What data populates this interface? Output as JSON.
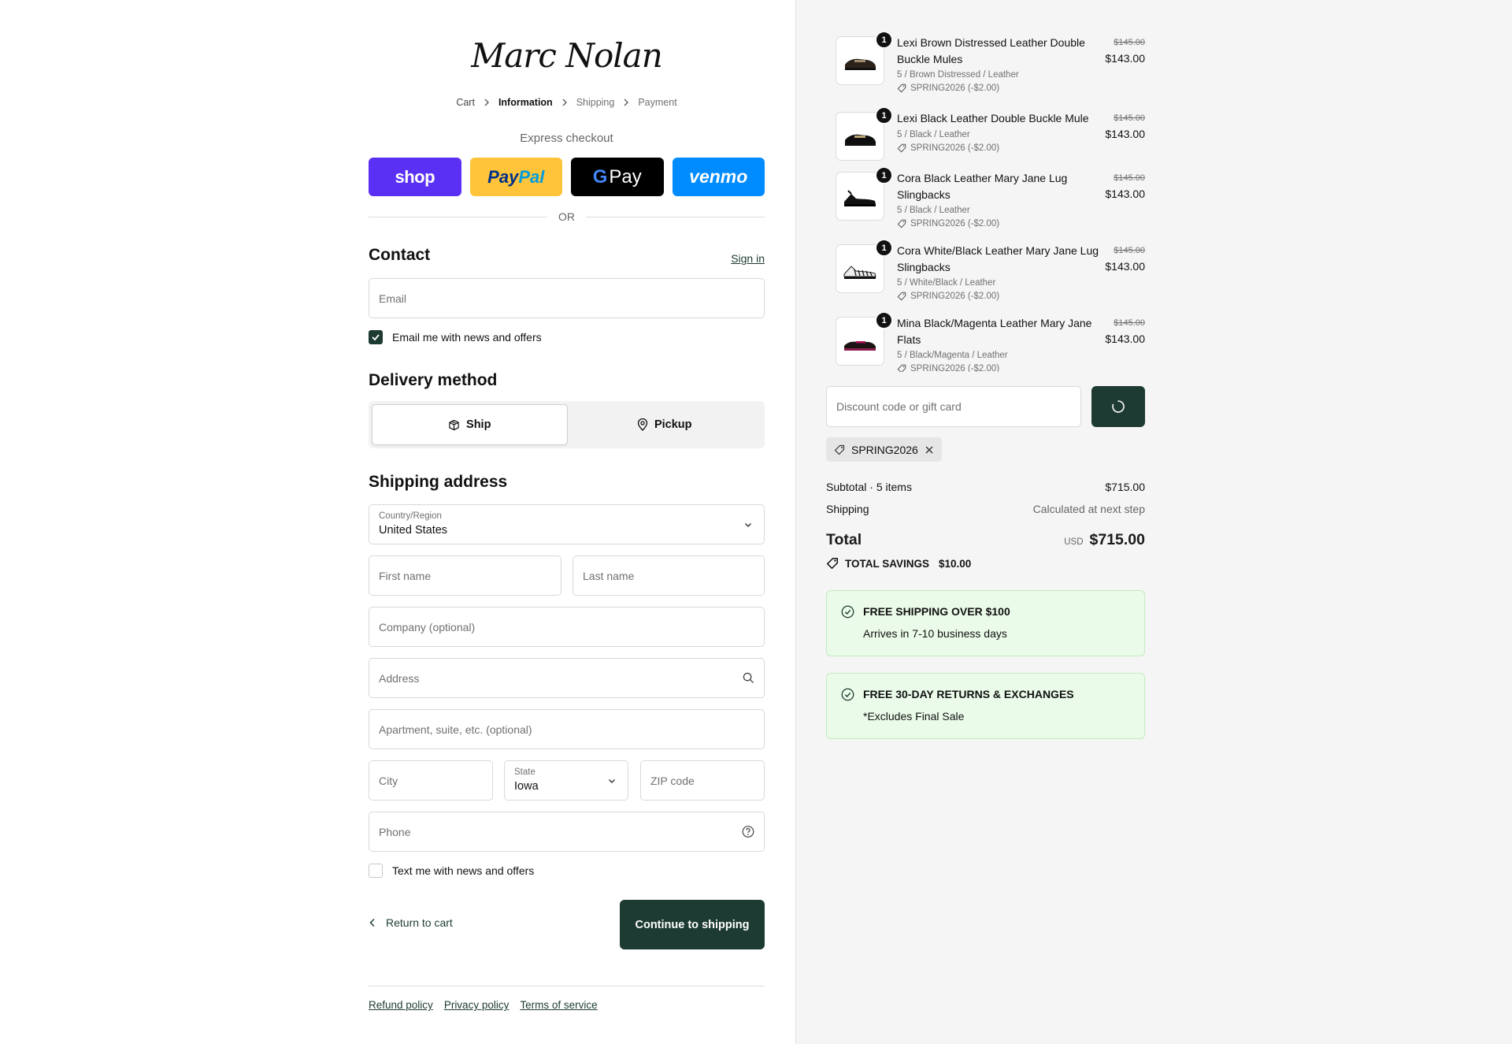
{
  "brand": {
    "logo_text": "Marc Nolan"
  },
  "breadcrumb": [
    "Cart",
    "Information",
    "Shipping",
    "Payment"
  ],
  "express": {
    "label": "Express checkout",
    "buttons": {
      "shop": "shop",
      "paypal_a": "Pay",
      "paypal_b": "Pal",
      "gpay_g": "G",
      "gpay": "Pay",
      "venmo": "venmo"
    },
    "or": "OR"
  },
  "contact": {
    "heading": "Contact",
    "signin": "Sign in",
    "email_placeholder": "Email",
    "news_label": "Email me with news and offers",
    "news_checked": true
  },
  "delivery": {
    "heading": "Delivery method",
    "ship": "Ship",
    "pickup": "Pickup",
    "selected": "Ship"
  },
  "shipping": {
    "heading": "Shipping address",
    "country_label": "Country/Region",
    "country_value": "United States",
    "first_name": "First name",
    "last_name": "Last name",
    "company": "Company (optional)",
    "address": "Address",
    "apartment": "Apartment, suite, etc. (optional)",
    "city": "City",
    "state_label": "State",
    "state_value": "Iowa",
    "zip": "ZIP code",
    "phone": "Phone",
    "sms_label": "Text me with news and offers",
    "sms_checked": false
  },
  "actions": {
    "return": "Return to cart",
    "continue": "Continue to shipping"
  },
  "footer": [
    "Refund policy",
    "Privacy policy",
    "Terms of service"
  ],
  "cart": {
    "items": [
      {
        "qty": "1",
        "name": "Lexi Brown Distressed Leather Double Buckle Mules",
        "variant": "5 / Brown Distressed / Leather",
        "discount": "SPRING2026 (-$2.00)",
        "original": "$145.00",
        "price": "$143.00"
      },
      {
        "qty": "1",
        "name": "Lexi Black Leather Double Buckle Mule",
        "variant": "5 / Black / Leather",
        "discount": "SPRING2026 (-$2.00)",
        "original": "$145.00",
        "price": "$143.00"
      },
      {
        "qty": "1",
        "name": "Cora Black Leather Mary Jane Lug Slingbacks",
        "variant": "5 / Black / Leather",
        "discount": "SPRING2026 (-$2.00)",
        "original": "$145.00",
        "price": "$143.00"
      },
      {
        "qty": "1",
        "name": "Cora White/Black Leather Mary Jane Lug Slingbacks",
        "variant": "5 / White/Black / Leather",
        "discount": "SPRING2026 (-$2.00)",
        "original": "$145.00",
        "price": "$143.00"
      },
      {
        "qty": "1",
        "name": "Mina Black/Magenta Leather Mary Jane Flats",
        "variant": "5 / Black/Magenta / Leather",
        "discount": "SPRING2026 (-$2.00)",
        "original": "$145.00",
        "price": "$143.00"
      }
    ],
    "discount_placeholder": "Discount code or gift card",
    "applied_code": "SPRING2026",
    "subtotal_label": "Subtotal · 5 items",
    "subtotal": "$715.00",
    "shipping_label": "Shipping",
    "shipping_value": "Calculated at next step",
    "total_label": "Total",
    "currency": "USD",
    "total": "$715.00",
    "savings_label": "TOTAL SAVINGS",
    "savings_value": "$10.00",
    "promos": [
      {
        "title": "FREE SHIPPING OVER $100",
        "sub": "Arrives in 7-10 business days"
      },
      {
        "title": "FREE 30-DAY RETURNS & EXCHANGES",
        "sub": "*Excludes Final Sale"
      }
    ]
  },
  "colors": {
    "accent": "#1d3b32",
    "promo_bg": "#eafbe9",
    "shop": "#5a31f4",
    "paypal": "#ffc439",
    "venmo": "#008cff"
  }
}
